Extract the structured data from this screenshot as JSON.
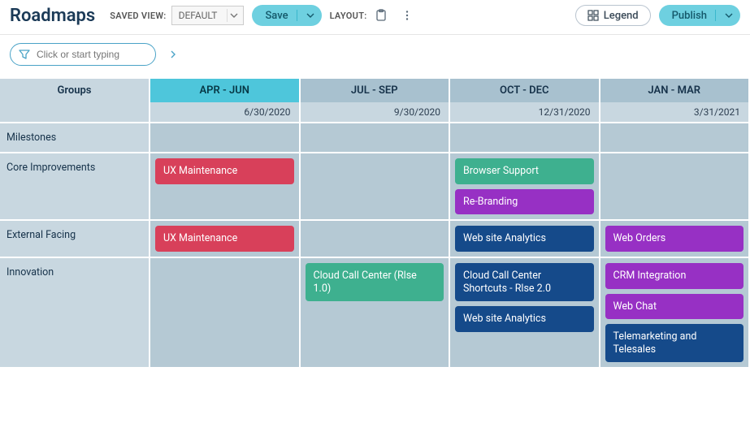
{
  "header": {
    "title": "Roadmaps",
    "saved_view_label": "SAVED VIEW:",
    "saved_view_value": "DEFAULT",
    "save_label": "Save",
    "layout_label": "LAYOUT:",
    "legend_label": "Legend",
    "publish_label": "Publish"
  },
  "filter": {
    "placeholder": "Click or start typing"
  },
  "columns": {
    "groups_header": "Groups",
    "quarters": [
      {
        "label": "APR - JUN",
        "end_date": "6/30/2020",
        "active": true
      },
      {
        "label": "JUL - SEP",
        "end_date": "9/30/2020",
        "active": false
      },
      {
        "label": "OCT - DEC",
        "end_date": "12/31/2020",
        "active": false
      },
      {
        "label": "JAN - MAR",
        "end_date": "3/31/2021",
        "active": false
      }
    ]
  },
  "rows": [
    {
      "group": "Milestones",
      "cells": [
        [],
        [],
        [],
        []
      ]
    },
    {
      "group": "Core Improvements",
      "cells": [
        [
          {
            "label": "UX Maintenance",
            "color": "red"
          }
        ],
        [],
        [
          {
            "label": "Browser Support",
            "color": "teal"
          },
          {
            "label": "Re-Branding",
            "color": "purple"
          }
        ],
        []
      ]
    },
    {
      "group": "External Facing",
      "cells": [
        [
          {
            "label": "UX Maintenance",
            "color": "red"
          }
        ],
        [],
        [
          {
            "label": "Web site Analytics",
            "color": "navy"
          }
        ],
        [
          {
            "label": "Web Orders",
            "color": "purple"
          }
        ]
      ]
    },
    {
      "group": "Innovation",
      "cells": [
        [],
        [
          {
            "label": "Cloud Call Center (Rlse 1.0)",
            "color": "teal"
          }
        ],
        [
          {
            "label": "Cloud Call Center Shortcuts - Rlse 2.0",
            "color": "navy"
          },
          {
            "label": "Web site Analytics",
            "color": "navy"
          }
        ],
        [
          {
            "label": "CRM Integration",
            "color": "purple"
          },
          {
            "label": "Web Chat",
            "color": "purple"
          },
          {
            "label": "Telemarketing and Telesales",
            "color": "navy"
          }
        ]
      ]
    }
  ],
  "colors": {
    "red": "#d8405a",
    "teal": "#3eb08f",
    "purple": "#9730c4",
    "navy": "#154a8a"
  }
}
